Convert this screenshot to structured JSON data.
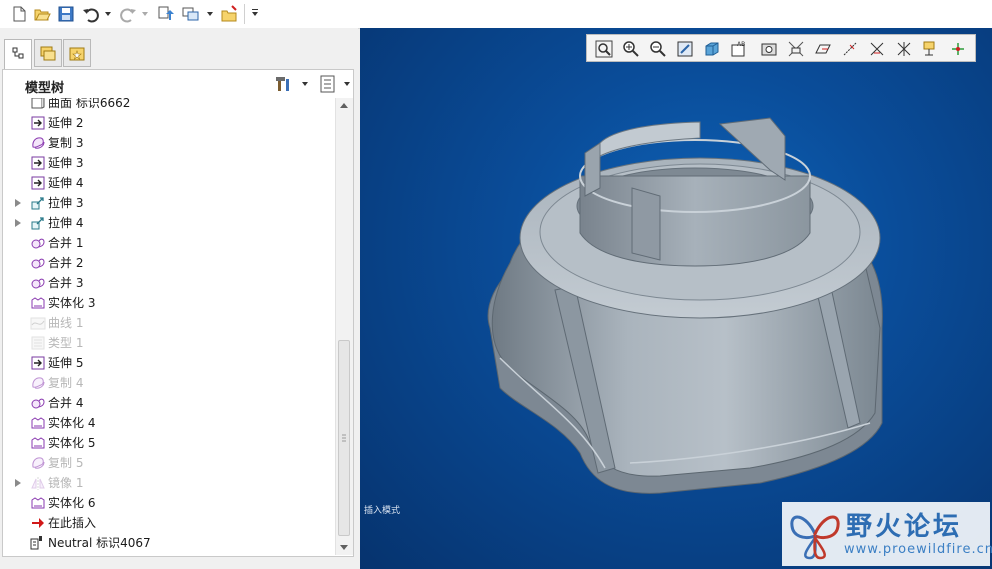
{
  "toolbar": {
    "buttons": [
      "new-icon",
      "open-icon",
      "save-icon",
      "undo-icon",
      "redo-icon",
      "regenerate-icon",
      "windows-icon",
      "close-window-icon",
      "customize-icon"
    ]
  },
  "left_panel": {
    "tabs": [
      "model-tree-tab",
      "folder-browser-tab",
      "favorites-tab"
    ],
    "active_tab": "model-tree-tab",
    "tree_title": "模型树",
    "tree_items": [
      {
        "label": "曲面 标识6662",
        "icon": "surface-icon",
        "expandable": false,
        "dim": false
      },
      {
        "label": "延伸 2",
        "icon": "extend-icon",
        "expandable": false,
        "dim": false
      },
      {
        "label": "复制 3",
        "icon": "copy-icon",
        "expandable": false,
        "dim": false
      },
      {
        "label": "延伸 3",
        "icon": "extend-icon",
        "expandable": false,
        "dim": false
      },
      {
        "label": "延伸 4",
        "icon": "extend-icon",
        "expandable": false,
        "dim": false
      },
      {
        "label": "拉伸 3",
        "icon": "extrude-icon",
        "expandable": true,
        "dim": false
      },
      {
        "label": "拉伸 4",
        "icon": "extrude-icon",
        "expandable": true,
        "dim": false
      },
      {
        "label": "合并 1",
        "icon": "merge-icon",
        "expandable": false,
        "dim": false
      },
      {
        "label": "合并 2",
        "icon": "merge-icon",
        "expandable": false,
        "dim": false
      },
      {
        "label": "合并 3",
        "icon": "merge-icon",
        "expandable": false,
        "dim": false
      },
      {
        "label": "实体化 3",
        "icon": "solidify-icon",
        "expandable": false,
        "dim": false
      },
      {
        "label": "曲线 1",
        "icon": "curve-icon",
        "expandable": false,
        "dim": true
      },
      {
        "label": "类型 1",
        "icon": "type-icon",
        "expandable": false,
        "dim": true
      },
      {
        "label": "延伸 5",
        "icon": "extend-icon",
        "expandable": false,
        "dim": false
      },
      {
        "label": "复制 4",
        "icon": "copy-icon",
        "expandable": false,
        "dim": true
      },
      {
        "label": "合并 4",
        "icon": "merge-icon",
        "expandable": false,
        "dim": false
      },
      {
        "label": "实体化 4",
        "icon": "solidify-icon",
        "expandable": false,
        "dim": false
      },
      {
        "label": "实体化 5",
        "icon": "solidify-icon",
        "expandable": false,
        "dim": false
      },
      {
        "label": "复制 5",
        "icon": "copy-icon",
        "expandable": false,
        "dim": true
      },
      {
        "label": "镜像 1",
        "icon": "mirror-icon",
        "expandable": true,
        "dim": true
      },
      {
        "label": "实体化 6",
        "icon": "solidify-icon",
        "expandable": false,
        "dim": false
      },
      {
        "label": "在此插入",
        "icon": "insert-here-arrow-icon",
        "expandable": false,
        "dim": false
      },
      {
        "label": "Neutral 标识4067",
        "icon": "neutral-icon",
        "expandable": false,
        "dim": false
      }
    ]
  },
  "viewport": {
    "toolbar_buttons": [
      "refit-icon",
      "zoom-in-icon",
      "zoom-out-icon",
      "repaint-icon",
      "display-style-icon",
      "saved-views-icon",
      "view-manager-icon",
      "datum-display-icon",
      "plane-tag-icon",
      "axis-tag-icon",
      "point-tag-icon",
      "csys-tag-icon",
      "annotation-display-icon",
      "spin-center-icon"
    ],
    "mode_label": "插入模式",
    "watermark": {
      "title": "野火论坛",
      "url": "www.proewildfire.cn"
    }
  },
  "colors": {
    "viewport_bg": "#0a4d9a",
    "model_gray": "#98a3ad",
    "accent": "#2d6db3"
  }
}
